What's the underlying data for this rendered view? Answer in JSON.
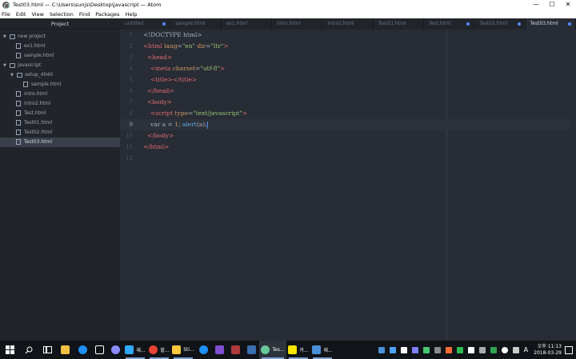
{
  "window": {
    "title": "Test03.html — C:\\Users\\sunjs\\Desktop\\javascript — Atom",
    "minimize": "—",
    "maximize": "☐",
    "close": "✕"
  },
  "menu": [
    "File",
    "Edit",
    "View",
    "Selection",
    "Find",
    "Packages",
    "Help"
  ],
  "tree": {
    "header": "Project",
    "rows": [
      {
        "label": "new project",
        "type": "folder"
      },
      {
        "label": "ex1.html",
        "type": "file"
      },
      {
        "label": "sample.html",
        "type": "file"
      },
      {
        "label": "javascript",
        "type": "folder"
      },
      {
        "label": "setup_4040",
        "type": "folder"
      },
      {
        "label": "sample.html",
        "type": "file"
      },
      {
        "label": "intro.html",
        "type": "file"
      },
      {
        "label": "intro2.html",
        "type": "file"
      },
      {
        "label": "Test.html",
        "type": "file"
      },
      {
        "label": "Test01.html",
        "type": "file"
      },
      {
        "label": "Test02.html",
        "type": "file"
      },
      {
        "label": "Test03.html",
        "type": "file",
        "selected": true
      }
    ]
  },
  "tabs": [
    {
      "label": "untitled",
      "modified": true
    },
    {
      "label": "sample.html",
      "modified": false
    },
    {
      "label": "ex1.html",
      "modified": false
    },
    {
      "label": "intro.html",
      "modified": false
    },
    {
      "label": "intro2.html",
      "modified": false
    },
    {
      "label": "Test01.html",
      "modified": false
    },
    {
      "label": "Test.html",
      "modified": true
    },
    {
      "label": "Test02.html",
      "modified": true
    },
    {
      "label": "Test03.html",
      "modified": true,
      "active": true
    }
  ],
  "editor": {
    "line_numbers": [
      "1",
      "2",
      "3",
      "4",
      "5",
      "6",
      "7",
      "8",
      "9",
      "10",
      "11",
      "12"
    ],
    "current_line": 9,
    "lines": {
      "l1": {
        "t0": "<!DOCTYPE html>"
      },
      "l2": {
        "t0": "<html",
        "t1": " lang",
        "t2": "=",
        "t3": "\"en\"",
        "t4": " dir",
        "t5": "=",
        "t6": "\"ltr\"",
        "t7": ">"
      },
      "l3": {
        "t0": "<head>"
      },
      "l4": {
        "t0": "<meta",
        "t1": " charset",
        "t2": "=",
        "t3": "\"utf-8\"",
        "t4": ">"
      },
      "l5": {
        "t0": "<title></title>"
      },
      "l6": {
        "t0": "</head>"
      },
      "l7": {
        "t0": "<body>"
      },
      "l8": {
        "t0": "<script",
        "t1": " type",
        "t2": "=",
        "t3": "\"text/javascript\"",
        "t4": ">"
      },
      "l9": {
        "t0": "var a = ",
        "t1": "1",
        "t2": "; ",
        "t3": "alert",
        "t4": "(a);"
      },
      "l10": {
        "t0": "</body>"
      },
      "l11": {
        "t0": "</html>"
      }
    }
  },
  "taskbar": {
    "items": [
      {
        "label": "",
        "color": "#ffffff",
        "name": "windows-start"
      },
      {
        "label": "",
        "color": "#ffffff",
        "name": "search"
      },
      {
        "label": "",
        "color": "#ffffff",
        "name": "task-view"
      },
      {
        "label": "",
        "color": "#f0c040",
        "name": "file-explorer"
      },
      {
        "label": "",
        "color": "#1e90ff",
        "name": "edge"
      },
      {
        "label": "",
        "color": "#ffffff",
        "name": "calendar"
      },
      {
        "label": "",
        "color": "#8a8aff",
        "name": "app"
      },
      {
        "label": "재...",
        "color": "#31a8ff",
        "name": "photoshop"
      },
      {
        "label": "쏼...",
        "color": "#ea4335",
        "name": "chrome"
      },
      {
        "label": "Sti...",
        "color": "#ffc83d",
        "name": "sticky-notes"
      },
      {
        "label": "",
        "color": "#1e90ff",
        "name": "ie"
      },
      {
        "label": "",
        "color": "#7f4fd3",
        "name": "visual-studio"
      },
      {
        "label": "",
        "color": "#b03a3a",
        "name": "app-red"
      },
      {
        "label": "",
        "color": "#3a6fb0",
        "name": "app-blue"
      },
      {
        "label": "Tes...",
        "color": "#66c99a",
        "name": "atom"
      },
      {
        "label": "카...",
        "color": "#f7e600",
        "name": "kakaotalk"
      },
      {
        "label": "재...",
        "color": "#4a90d9",
        "name": "app-doc"
      }
    ],
    "tray_colors": [
      "#4a90d9",
      "#4aa3ff",
      "#ffffff",
      "#7f7fff",
      "#48c774",
      "#8a8a8a",
      "#ff6b35",
      "#2dbb4e",
      "#ffffff",
      "#aaaaaa",
      "#2ea44f",
      "#ffffff",
      "#cccccc",
      "#ffffff"
    ],
    "tray_last": "A",
    "clock": {
      "ampm_time": "오후 11:13",
      "date": "2018-03-29"
    }
  }
}
